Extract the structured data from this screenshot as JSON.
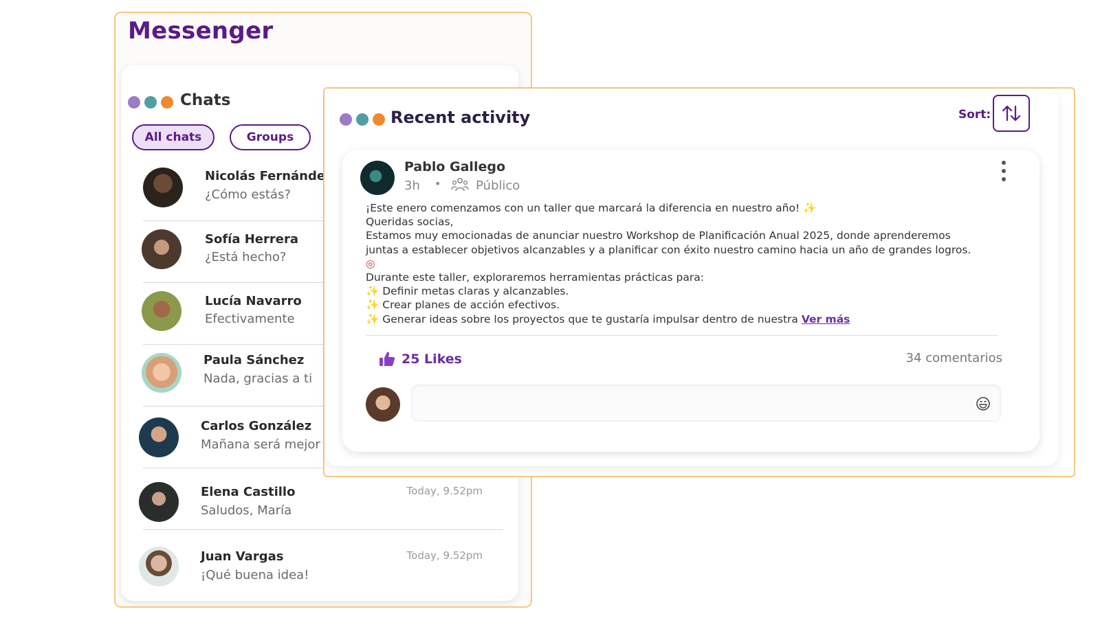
{
  "colors": {
    "brand_purple": "#5b1a86",
    "frame_orange": "#f4c882",
    "dot_purple": "#9b7cc6",
    "dot_teal": "#4f9ea2",
    "dot_orange": "#f08a2e"
  },
  "messenger": {
    "title": "Messenger",
    "chats_title": "Chats",
    "tabs": [
      {
        "label": "All chats",
        "selected": true
      },
      {
        "label": "Groups",
        "selected": false
      }
    ],
    "chats": [
      {
        "name": "Nicolás Fernández",
        "message": "¿Cómo estás?",
        "time": ""
      },
      {
        "name": "Sofía Herrera",
        "message": "¿Está hecho?",
        "time": ""
      },
      {
        "name": "Lucía Navarro",
        "message": "Efectivamente",
        "time": ""
      },
      {
        "name": "Paula Sánchez",
        "message": "Nada, gracias a ti",
        "time": ""
      },
      {
        "name": "Carlos González",
        "message": "Mañana será mejor",
        "time": ""
      },
      {
        "name": "Elena Castillo",
        "message": "Saludos, María",
        "time": "Today, 9.52pm"
      },
      {
        "name": "Juan Vargas",
        "message": "¡Qué buena idea!",
        "time": "Today, 9.52pm"
      }
    ]
  },
  "activity": {
    "title": "Recent activity",
    "sort_label": "Sort:",
    "post": {
      "author": "Pablo Gallego",
      "time": "3h",
      "separator": "•",
      "visibility": "Público",
      "lines": [
        "¡Este enero comenzamos con un taller que marcará la diferencia en nuestro año! ",
        "Queridas socias,",
        "Estamos muy emocionadas de anunciar nuestro Workshop de Planificación Anual 2025, donde aprenderemos",
        "juntas a establecer objetivos alcanzables y a planificar con éxito nuestro camino hacia un año de grandes logros.",
        "",
        "Durante este taller, exploraremos herramientas prácticas para:",
        "Definir metas claras y alcanzables.",
        "Crear planes de acción efectivos.",
        "Generar ideas sobre los proyectos que te gustaría impulsar dentro de nuestra "
      ],
      "see_more": "Ver más",
      "likes": "25 Likes",
      "comments": "34 comentarios",
      "comment_placeholder": ""
    }
  },
  "icons": {
    "sort": "sort-arrows-icon",
    "more": "more-vertical-icon",
    "like": "thumbs-up-icon",
    "emoji": "emoji-icon",
    "people": "people-icon",
    "sparkle": "sparkle-icon",
    "target": "target-icon"
  }
}
